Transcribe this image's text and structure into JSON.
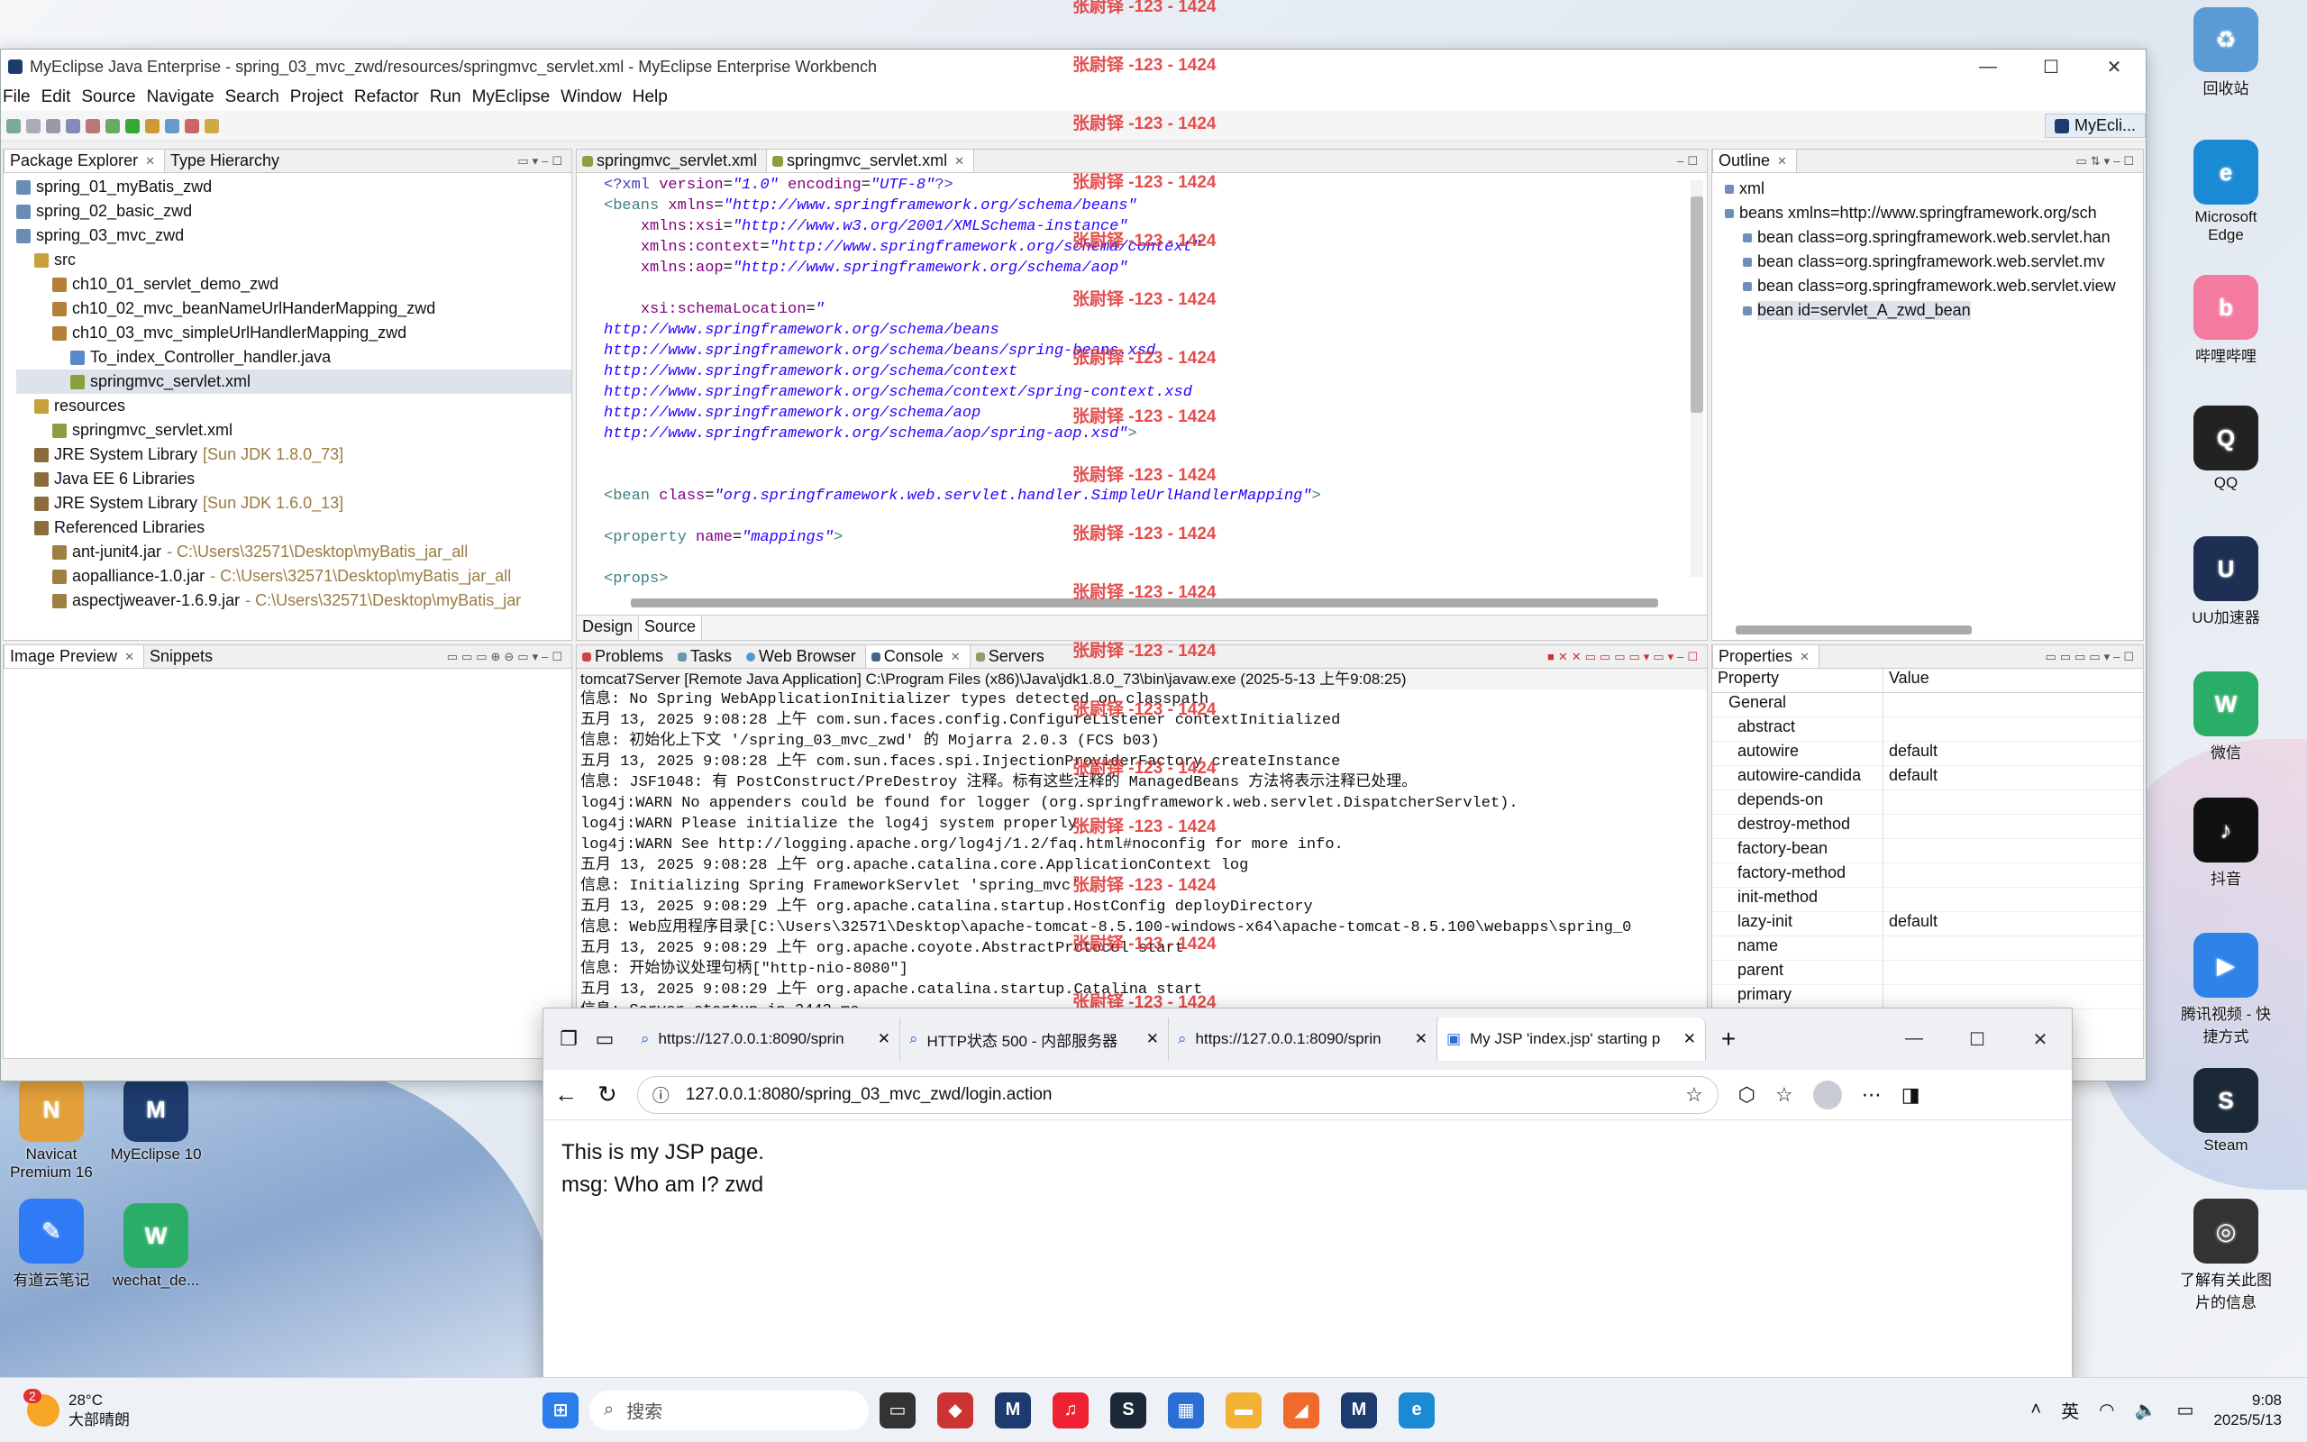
{
  "desktop": {
    "right_icons": [
      {
        "label": "回收站",
        "color": "#5b9bd5",
        "glyph": "♻"
      },
      {
        "label": "Microsoft Edge",
        "color": "#1b8ad4",
        "glyph": "e"
      },
      {
        "label": "哔哩哔哩",
        "color": "#f57aa0",
        "glyph": "b"
      },
      {
        "label": "QQ",
        "color": "#222",
        "glyph": "Q"
      },
      {
        "label": "UU加速器",
        "color": "#1d2f52",
        "glyph": "U"
      },
      {
        "label": "微信",
        "color": "#2aae67",
        "glyph": "W"
      },
      {
        "label": "抖音",
        "color": "#111",
        "glyph": "♪"
      },
      {
        "label": "腾讯视频 - 快捷方式",
        "color": "#2f83e8",
        "glyph": "▶"
      },
      {
        "label": "Steam",
        "color": "#1b2838",
        "glyph": "S"
      },
      {
        "label": "了解有关此图片的信息",
        "color": "#333",
        "glyph": "◎"
      }
    ],
    "left_icons": [
      {
        "label": "Navicat Premium 16",
        "color": "#e3a03a",
        "glyph": "N"
      },
      {
        "label": "MyEclipse 10",
        "color": "#1d3b6e",
        "glyph": "M"
      },
      {
        "label": "有道云笔记",
        "color": "#2f7bf5",
        "glyph": "✎"
      },
      {
        "label": "wechat_de...",
        "color": "#2aae67",
        "glyph": "W"
      }
    ]
  },
  "watermark": "张尉铎 -123 - 1424",
  "eclipse": {
    "title": "MyEclipse Java Enterprise - spring_03_mvc_zwd/resources/springmvc_servlet.xml - MyEclipse Enterprise Workbench",
    "menu": [
      "File",
      "Edit",
      "Source",
      "Navigate",
      "Search",
      "Project",
      "Refactor",
      "Run",
      "MyEclipse",
      "Window",
      "Help"
    ],
    "perspective": "MyEcli...",
    "package_explorer": {
      "tabs": [
        "Package Explorer",
        "Type Hierarchy"
      ],
      "rows": [
        {
          "indent": 0,
          "text": "spring_01_myBatis_zwd",
          "extra": "",
          "icon": "#6a8db5"
        },
        {
          "indent": 0,
          "text": "spring_02_basic_zwd",
          "extra": "",
          "icon": "#6a8db5"
        },
        {
          "indent": 0,
          "text": "spring_03_mvc_zwd",
          "extra": "",
          "icon": "#6a8db5"
        },
        {
          "indent": 1,
          "text": "src",
          "extra": "",
          "icon": "#c7a03a"
        },
        {
          "indent": 2,
          "text": "ch10_01_servlet_demo_zwd",
          "extra": "",
          "icon": "#b5803a"
        },
        {
          "indent": 2,
          "text": "ch10_02_mvc_beanNameUrlHanderMapping_zwd",
          "extra": "",
          "icon": "#b5803a"
        },
        {
          "indent": 2,
          "text": "ch10_03_mvc_simpleUrlHandlerMapping_zwd",
          "extra": "",
          "icon": "#b5803a"
        },
        {
          "indent": 3,
          "text": "To_index_Controller_handler.java",
          "extra": "",
          "icon": "#5b8ac9"
        },
        {
          "indent": 3,
          "text": "springmvc_servlet.xml",
          "extra": "",
          "icon": "#8aa040",
          "selected": true
        },
        {
          "indent": 1,
          "text": "resources",
          "extra": "",
          "icon": "#c7a03a"
        },
        {
          "indent": 2,
          "text": "springmvc_servlet.xml",
          "extra": "",
          "icon": "#8aa040"
        },
        {
          "indent": 1,
          "text": "JRE System Library",
          "extra": "[Sun JDK 1.8.0_73]",
          "icon": "#8a6d3b"
        },
        {
          "indent": 1,
          "text": "Java EE 6 Libraries",
          "extra": "",
          "icon": "#8a6d3b"
        },
        {
          "indent": 1,
          "text": "JRE System Library",
          "extra": "[Sun JDK 1.6.0_13]",
          "icon": "#8a6d3b"
        },
        {
          "indent": 1,
          "text": "Referenced Libraries",
          "extra": "",
          "icon": "#8a6d3b"
        },
        {
          "indent": 2,
          "text": "ant-junit4.jar",
          "extra": "- C:\\Users\\32571\\Desktop\\myBatis_jar_all",
          "icon": "#a08040"
        },
        {
          "indent": 2,
          "text": "aopalliance-1.0.jar",
          "extra": "- C:\\Users\\32571\\Desktop\\myBatis_jar_all",
          "icon": "#a08040"
        },
        {
          "indent": 2,
          "text": "aspectjweaver-1.6.9.jar",
          "extra": "- C:\\Users\\32571\\Desktop\\myBatis_jar",
          "icon": "#a08040"
        }
      ]
    },
    "editor": {
      "tabs": [
        "springmvc_servlet.xml",
        "springmvc_servlet.xml"
      ],
      "bottom_tabs": [
        "Design",
        "Source"
      ],
      "lines": [
        [
          {
            "c": "pi",
            "t": "<?xml "
          },
          {
            "c": "at",
            "t": "version"
          },
          {
            "c": "",
            "t": "="
          },
          {
            "c": "st",
            "t": "\"1.0\""
          },
          {
            "c": "",
            "t": " "
          },
          {
            "c": "at",
            "t": "encoding"
          },
          {
            "c": "",
            "t": "="
          },
          {
            "c": "st",
            "t": "\"UTF-8\""
          },
          {
            "c": "pi",
            "t": "?>"
          }
        ],
        [
          {
            "c": "kw",
            "t": "<beans "
          },
          {
            "c": "at",
            "t": "xmlns"
          },
          {
            "c": "",
            "t": "="
          },
          {
            "c": "st",
            "t": "\"http://www.springframework.org/schema/beans\""
          }
        ],
        [
          {
            "c": "",
            "t": "    "
          },
          {
            "c": "at",
            "t": "xmlns:xsi"
          },
          {
            "c": "",
            "t": "="
          },
          {
            "c": "st",
            "t": "\"http://www.w3.org/2001/XMLSchema-instance\""
          }
        ],
        [
          {
            "c": "",
            "t": "    "
          },
          {
            "c": "at",
            "t": "xmlns:context"
          },
          {
            "c": "",
            "t": "="
          },
          {
            "c": "st",
            "t": "\"http://www.springframework.org/schema/context\""
          }
        ],
        [
          {
            "c": "",
            "t": "    "
          },
          {
            "c": "at",
            "t": "xmlns:aop"
          },
          {
            "c": "",
            "t": "="
          },
          {
            "c": "st",
            "t": "\"http://www.springframework.org/schema/aop\""
          }
        ],
        [
          {
            "c": "",
            "t": ""
          }
        ],
        [
          {
            "c": "",
            "t": "    "
          },
          {
            "c": "at",
            "t": "xsi:schemaLocation"
          },
          {
            "c": "",
            "t": "="
          },
          {
            "c": "st",
            "t": "\""
          }
        ],
        [
          {
            "c": "st",
            "t": "http://www.springframework.org/schema/beans"
          }
        ],
        [
          {
            "c": "st",
            "t": "http://www.springframework.org/schema/beans/spring-beans.xsd"
          }
        ],
        [
          {
            "c": "st",
            "t": "http://www.springframework.org/schema/context"
          }
        ],
        [
          {
            "c": "st",
            "t": "http://www.springframework.org/schema/context/spring-context.xsd"
          }
        ],
        [
          {
            "c": "st",
            "t": "http://www.springframework.org/schema/aop"
          }
        ],
        [
          {
            "c": "st",
            "t": "http://www.springframework.org/schema/aop/spring-aop.xsd\""
          },
          {
            "c": "kw",
            "t": ">"
          }
        ],
        [
          {
            "c": "",
            "t": ""
          }
        ],
        [
          {
            "c": "",
            "t": ""
          }
        ],
        [
          {
            "c": "kw",
            "t": "<bean "
          },
          {
            "c": "at",
            "t": "class"
          },
          {
            "c": "",
            "t": "="
          },
          {
            "c": "st",
            "t": "\"org.springframework.web.servlet.handler.SimpleUrlHandlerMapping\""
          },
          {
            "c": "kw",
            "t": ">"
          }
        ],
        [
          {
            "c": "",
            "t": ""
          }
        ],
        [
          {
            "c": "kw",
            "t": "<property "
          },
          {
            "c": "at",
            "t": "name"
          },
          {
            "c": "",
            "t": "="
          },
          {
            "c": "st",
            "t": "\"mappings\""
          },
          {
            "c": "kw",
            "t": ">"
          }
        ],
        [
          {
            "c": "",
            "t": ""
          }
        ],
        [
          {
            "c": "kw",
            "t": "<props>"
          }
        ]
      ]
    },
    "outline": {
      "tab": "Outline",
      "rows": [
        {
          "indent": 0,
          "text": "xml"
        },
        {
          "indent": 0,
          "text": "beans xmlns=http://www.springframework.org/sch"
        },
        {
          "indent": 1,
          "text": "bean class=org.springframework.web.servlet.han"
        },
        {
          "indent": 1,
          "text": "bean class=org.springframework.web.servlet.mv"
        },
        {
          "indent": 1,
          "text": "bean class=org.springframework.web.servlet.view"
        },
        {
          "indent": 1,
          "text": "bean id=servlet_A_zwd_bean",
          "selected": true
        }
      ]
    },
    "image_preview": {
      "tabs": [
        "Image Preview",
        "Snippets"
      ]
    },
    "console": {
      "tabs": [
        "Problems",
        "Tasks",
        "Web Browser",
        "Console",
        "Servers"
      ],
      "header": "tomcat7Server [Remote Java Application] C:\\Program Files (x86)\\Java\\jdk1.8.0_73\\bin\\javaw.exe (2025-5-13 上午9:08:25)",
      "lines": [
        "信息: No Spring WebApplicationInitializer types detected on classpath",
        "五月 13, 2025 9:08:28 上午 com.sun.faces.config.ConfigureListener contextInitialized",
        "信息: 初始化上下文 '/spring_03_mvc_zwd' 的 Mojarra 2.0.3 (FCS b03)",
        "五月 13, 2025 9:08:28 上午 com.sun.faces.spi.InjectionProviderFactory createInstance",
        "信息: JSF1048: 有 PostConstruct/PreDestroy 注释。标有这些注释的 ManagedBeans 方法将表示注释已处理。",
        "log4j:WARN No appenders could be found for logger (org.springframework.web.servlet.DispatcherServlet).",
        "log4j:WARN Please initialize the log4j system properly.",
        "log4j:WARN See http://logging.apache.org/log4j/1.2/faq.html#noconfig for more info.",
        "五月 13, 2025 9:08:28 上午 org.apache.catalina.core.ApplicationContext log",
        "信息: Initializing Spring FrameworkServlet 'spring_mvc'",
        "五月 13, 2025 9:08:29 上午 org.apache.catalina.startup.HostConfig deployDirectory",
        "信息: Web应用程序目录[C:\\Users\\32571\\Desktop\\apache-tomcat-8.5.100-windows-x64\\apache-tomcat-8.5.100\\webapps\\spring_0",
        "五月 13, 2025 9:08:29 上午 org.apache.coyote.AbstractProtocol start",
        "信息: 开始协议处理句柄[\"http-nio-8080\"]",
        "五月 13, 2025 9:08:29 上午 org.apache.catalina.startup.Catalina start",
        "信息: Server startup in 3443 ms"
      ]
    },
    "properties": {
      "tab": "Properties",
      "headers": [
        "Property",
        "Value"
      ],
      "group": "General",
      "rows": [
        {
          "k": "abstract",
          "v": ""
        },
        {
          "k": "autowire",
          "v": "default"
        },
        {
          "k": "autowire-candida",
          "v": "default"
        },
        {
          "k": "depends-on",
          "v": ""
        },
        {
          "k": "destroy-method",
          "v": ""
        },
        {
          "k": "factory-bean",
          "v": ""
        },
        {
          "k": "factory-method",
          "v": ""
        },
        {
          "k": "init-method",
          "v": ""
        },
        {
          "k": "lazy-init",
          "v": "default"
        },
        {
          "k": "name",
          "v": ""
        },
        {
          "k": "parent",
          "v": ""
        },
        {
          "k": "primary",
          "v": ""
        }
      ]
    }
  },
  "browser": {
    "tabs": [
      {
        "label": "https://127.0.0.1:8090/sprin",
        "active": false
      },
      {
        "label": "HTTP状态 500 - 内部服务器",
        "active": false
      },
      {
        "label": "https://127.0.0.1:8090/sprin",
        "active": false
      },
      {
        "label": "My JSP 'index.jsp' starting p",
        "active": true
      }
    ],
    "url": "127.0.0.1:8080/spring_03_mvc_zwd/login.action",
    "content": [
      "This is my JSP page.",
      "msg: Who am I? zwd"
    ]
  },
  "taskbar": {
    "weather_temp": "28°C",
    "weather_desc": "大部晴朗",
    "weather_badge": "2",
    "search_placeholder": "搜索",
    "ime": "英",
    "time": "9:08",
    "date": "2025/5/13"
  }
}
